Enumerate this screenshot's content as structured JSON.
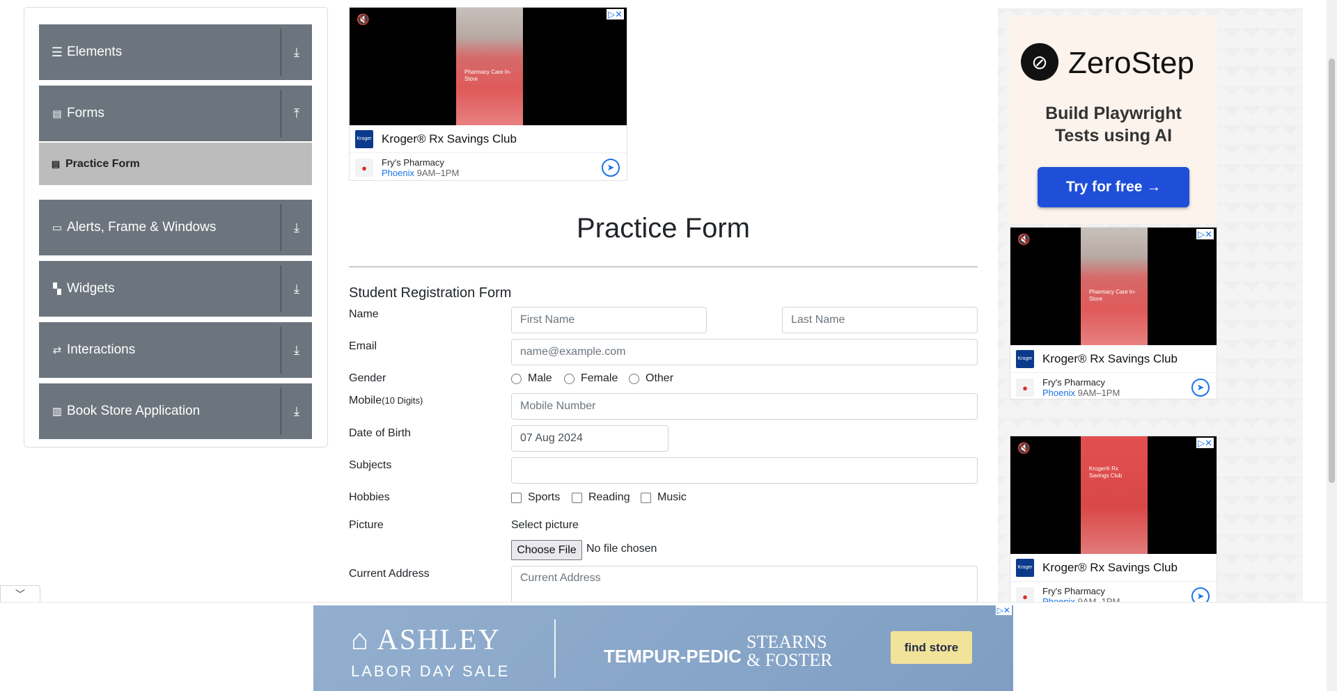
{
  "sidebar": {
    "groups": [
      {
        "label": "Elements",
        "icon": "hamburger-icon",
        "action_icon": "download-icon"
      },
      {
        "label": "Forms",
        "icon": "document-icon",
        "action_icon": "upload-icon"
      },
      {
        "label": "Alerts, Frame & Windows",
        "icon": "window-icon",
        "action_icon": "download-icon"
      },
      {
        "label": "Widgets",
        "icon": "widgets-icon",
        "action_icon": "download-icon"
      },
      {
        "label": "Interactions",
        "icon": "interactions-icon",
        "action_icon": "download-icon"
      },
      {
        "label": "Book Store Application",
        "icon": "books-icon",
        "action_icon": "download-icon"
      }
    ],
    "active_item": {
      "label": "Practice Form",
      "icon": "form-icon"
    }
  },
  "ads": {
    "kroger": {
      "thumb_text": "Pharmacy Care In-Store",
      "thumb_text_alt": "Kroger® Rx Savings Club",
      "brand": "Kroger® Rx Savings Club",
      "logo_text": "Kroger",
      "location_name": "Fry's Pharmacy",
      "city": "Phoenix",
      "hours": "9AM–1PM",
      "flags": "▷✕"
    },
    "zerostep": {
      "name": "ZeroStep",
      "tagline_1": "Build Playwright",
      "tagline_2": "Tests using AI",
      "button": "Try for free →"
    },
    "ashley": {
      "brand": "ASHLEY",
      "sale": "LABOR DAY SALE",
      "partner_1": "TEMPUR-PEDIC",
      "partner_2_line1": "STEARNS",
      "partner_2_line2": "& FOSTER",
      "button": "find store",
      "flags": "▷✕"
    }
  },
  "form": {
    "title": "Practice Form",
    "subtitle": "Student Registration Form",
    "labels": {
      "name": "Name",
      "email": "Email",
      "gender": "Gender",
      "mobile": "Mobile",
      "mobile_hint": "(10 Digits)",
      "dob": "Date of Birth",
      "subjects": "Subjects",
      "hobbies": "Hobbies",
      "picture": "Picture",
      "address": "Current Address"
    },
    "placeholders": {
      "first_name": "First Name",
      "last_name": "Last Name",
      "email": "name@example.com",
      "mobile": "Mobile Number",
      "address": "Current Address"
    },
    "dob_value": "07 Aug 2024",
    "genders": [
      "Male",
      "Female",
      "Other"
    ],
    "hobbies": [
      "Sports",
      "Reading",
      "Music"
    ],
    "picture_label": "Select picture",
    "file_button": "Choose File",
    "file_status": "No file chosen"
  },
  "bottom": {
    "collapse_icon": "chevron-down-icon"
  }
}
